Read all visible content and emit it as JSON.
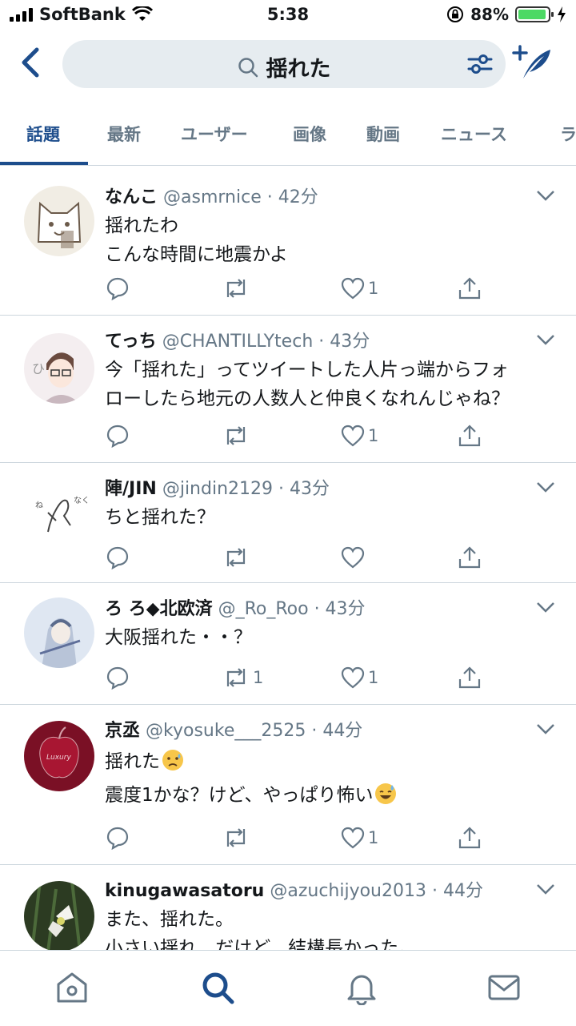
{
  "status": {
    "carrier": "SoftBank",
    "time": "5:38",
    "battery": "88%"
  },
  "search": {
    "query": "揺れた"
  },
  "tabs": [
    {
      "label": "話題",
      "active": true
    },
    {
      "label": "最新"
    },
    {
      "label": "ユーザー"
    },
    {
      "label": "画像"
    },
    {
      "label": "動画"
    },
    {
      "label": "ニュース"
    },
    {
      "label": "ラ"
    }
  ],
  "tweets": [
    {
      "name": "なんこ",
      "handle": "@asmrnice · 42分",
      "lines": [
        "揺れたわ",
        "こんな時間に地震かよ"
      ],
      "retweets": "",
      "likes": "1"
    },
    {
      "name": "てっち",
      "handle": "@CHANTILLYtech · 43分",
      "lines": [
        "今「揺れた」ってツイートした人片っ端からフォ",
        "ローしたら地元の人数人と仲良くなれんじゃね？"
      ],
      "retweets": "",
      "likes": "1"
    },
    {
      "name": "陣/JIN",
      "handle": "@jindin2129 · 43分",
      "lines": [
        "ちと揺れた？"
      ],
      "retweets": "",
      "likes": ""
    },
    {
      "name": "ろ ろ◆北欧済",
      "handle": "@_Ro_Roo · 43分",
      "lines": [
        "大阪揺れた・・？"
      ],
      "retweets": "1",
      "likes": "1"
    },
    {
      "name": "京丞",
      "handle": "@kyosuke___2525 · 44分",
      "lines": [
        "揺れた",
        "震度1かな？けど、やっぱり怖い"
      ],
      "retweets": "",
      "likes": "1"
    },
    {
      "name": "kinugawasatoru",
      "handle": "@azuchijyou2013 · 44分",
      "lines": [
        "また、揺れた。",
        "小さい揺れ、だけど、結構長かった。"
      ],
      "retweets": "",
      "likes": ""
    }
  ]
}
